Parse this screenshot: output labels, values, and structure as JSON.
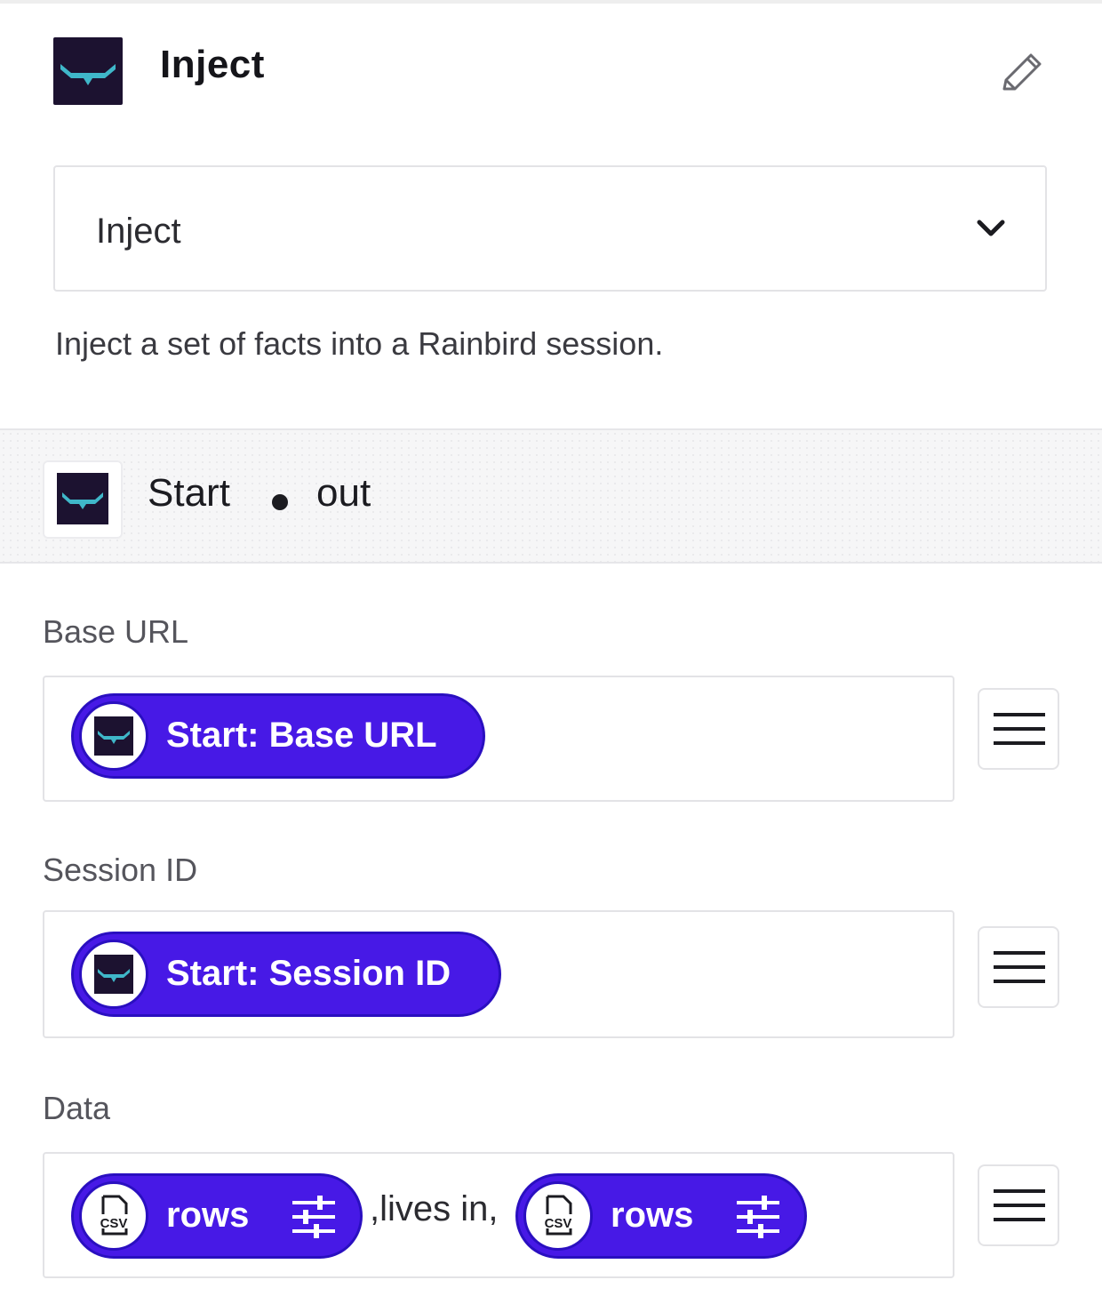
{
  "header": {
    "title": "Inject",
    "logo_icon": "rainbird-logo-icon",
    "edit_icon": "pencil-icon"
  },
  "action_select": {
    "value": "Inject",
    "icon": "chevron-down-icon"
  },
  "description": "Inject a set of facts into a Rainbird session.",
  "step_banner": {
    "step_name": "Start",
    "output_name": "out"
  },
  "fields": {
    "base_url": {
      "label": "Base URL",
      "pill_label": "Start: Base URL"
    },
    "session_id": {
      "label": "Session ID",
      "pill_label": "Start: Session ID"
    },
    "data": {
      "label": "Data",
      "pill_1_label": "rows",
      "separator": ",lives in,",
      "pill_2_label": "rows",
      "pill_icon_text": "CSV"
    }
  },
  "colors": {
    "pill_bg": "#4719e6",
    "logo_bg": "#1c1230",
    "logo_accent": "#3fb7c9"
  }
}
